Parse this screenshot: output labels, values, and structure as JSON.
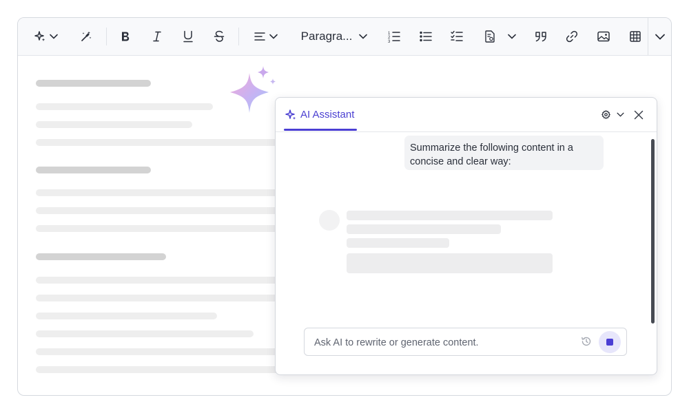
{
  "toolbar": {
    "paragraph_label": "Paragra...",
    "buttons": [
      "ai-sparkle",
      "magic-wand",
      "bold",
      "italic",
      "underline",
      "strikethrough",
      "align",
      "paragraph-format",
      "numbered-list",
      "bulleted-list",
      "todo-list",
      "insert-template",
      "blockquote",
      "link",
      "image",
      "table",
      "more"
    ]
  },
  "assistant": {
    "tab_title": "AI Assistant",
    "prompt_message": "Summarize the following content in a concise and clear way:",
    "input_placeholder": "Ask AI to rewrite or generate content.",
    "accent_color": "#4b3fd4"
  },
  "icons": {
    "sparkle": "sparkle-icon",
    "settings": "gear-icon",
    "close": "close-icon",
    "history": "history-icon",
    "stop": "stop-icon"
  }
}
